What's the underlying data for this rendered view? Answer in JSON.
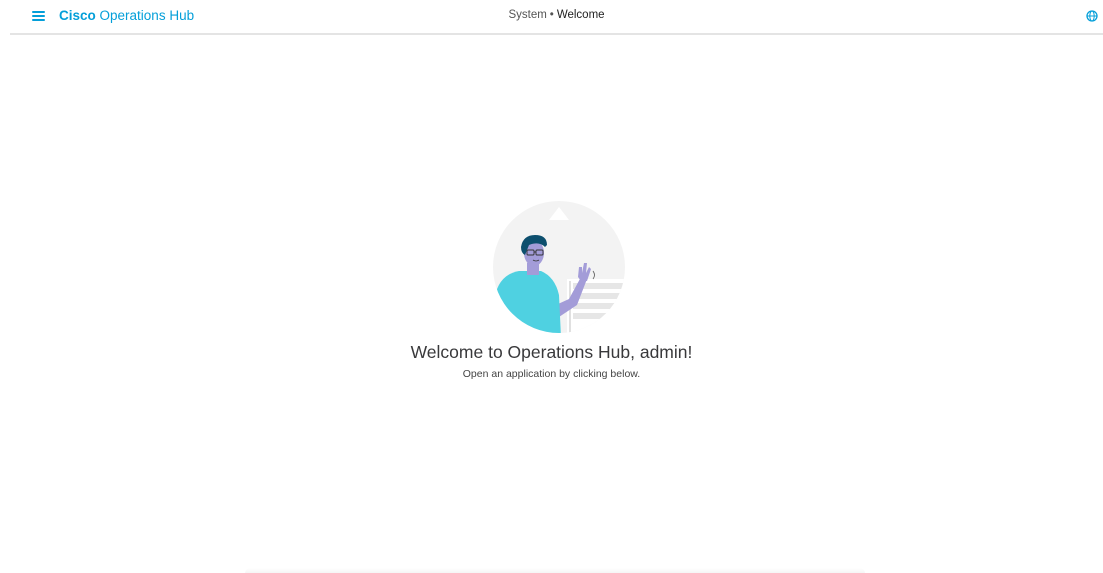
{
  "header": {
    "brand_bold": "Cisco",
    "brand_rest": "Operations Hub",
    "breadcrumb": {
      "parent": "System",
      "separator": "•",
      "current": "Welcome"
    }
  },
  "icons": {
    "menu": "hamburger-menu-icon",
    "globe": "globe-icon"
  },
  "welcome": {
    "title": "Welcome to Operations Hub, admin!",
    "subtitle": "Open an application by clicking below."
  },
  "colors": {
    "brand": "#049fd9",
    "accent_shirt": "#4fd1e1",
    "skin": "#a39cd8"
  }
}
